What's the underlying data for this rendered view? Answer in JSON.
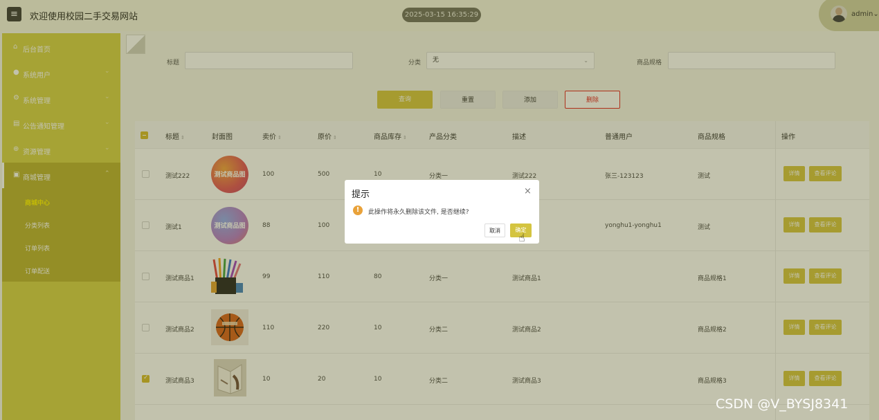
{
  "header": {
    "menu_icon": "≡",
    "site_title": "欢迎使用校园二手交易网站",
    "datetime": "2025-03-15 16:35:29",
    "user_name": "admin",
    "user_chevron": "⌄"
  },
  "sidebar": {
    "items": [
      {
        "label": "后台首页",
        "icon": "⌂",
        "chevron": ""
      },
      {
        "label": "系统用户",
        "icon": "●",
        "chevron": "⌄"
      },
      {
        "label": "系统管理",
        "icon": "⚙",
        "chevron": "⌄"
      },
      {
        "label": "公告通知管理",
        "icon": "▤",
        "chevron": "⌄"
      },
      {
        "label": "资源管理",
        "icon": "⊕",
        "chevron": "⌄"
      },
      {
        "label": "商城管理",
        "icon": "▣",
        "chevron": "⌃"
      }
    ],
    "sub_items": [
      {
        "label": "商城中心",
        "active": true
      },
      {
        "label": "分类列表",
        "active": false
      },
      {
        "label": "订单列表",
        "active": false
      },
      {
        "label": "订单配送",
        "active": false
      }
    ]
  },
  "filters": {
    "title_label": "标题",
    "title_value": "",
    "category_label": "分类",
    "category_value": "无",
    "spec_label": "商品规格",
    "spec_value": ""
  },
  "buttons": {
    "query": "查询",
    "reset": "重置",
    "add": "添加",
    "delete": "删除"
  },
  "table": {
    "headers": {
      "title": "标题",
      "cover": "封面图",
      "price": "卖价",
      "orig_price": "原价",
      "stock": "商品库存",
      "category": "产品分类",
      "desc": "描述",
      "user": "普通用户",
      "spec": "商品规格",
      "ops": "操作"
    },
    "sort_icon": "⇕",
    "rows": [
      {
        "title": "测试222",
        "cover_text": "测试商品图",
        "price": "100",
        "orig_price": "500",
        "stock": "10",
        "category": "分类一",
        "desc": "测试222",
        "user": "张三-123123",
        "spec": "测试",
        "detail": "详情",
        "reviews": "查看评论"
      },
      {
        "title": "测试1",
        "cover_text": "测试商品图",
        "price": "88",
        "orig_price": "100",
        "stock": "",
        "category": "",
        "desc": "",
        "user": "yonghu1-yonghu1",
        "spec": "测试",
        "detail": "详情",
        "reviews": "查看评论"
      },
      {
        "title": "测试商品1",
        "cover_text": "",
        "price": "99",
        "orig_price": "110",
        "stock": "80",
        "category": "分类一",
        "desc": "测试商品1",
        "user": "",
        "spec": "商品规格1",
        "detail": "详情",
        "reviews": "查看评论"
      },
      {
        "title": "测试商品2",
        "cover_text": "",
        "price": "110",
        "orig_price": "220",
        "stock": "10",
        "category": "分类二",
        "desc": "测试商品2",
        "user": "",
        "spec": "商品规格2",
        "detail": "详情",
        "reviews": "查看评论"
      },
      {
        "title": "测试商品3",
        "cover_text": "",
        "price": "10",
        "orig_price": "20",
        "stock": "10",
        "category": "分类二",
        "desc": "测试商品3",
        "user": "",
        "spec": "商品规格3",
        "detail": "详情",
        "reviews": "查看评论"
      }
    ]
  },
  "dialog": {
    "title": "提示",
    "close": "×",
    "warn_icon": "!",
    "message": "此操作将永久删除该文件, 是否继续?",
    "cancel": "取消",
    "confirm": "确定"
  },
  "watermark": "CSDN @V_BYSJ8341",
  "colors": {
    "accent": "#d4c440",
    "sidebar": "#d4cf47",
    "danger": "#e02020",
    "warning": "#e9a23a"
  }
}
